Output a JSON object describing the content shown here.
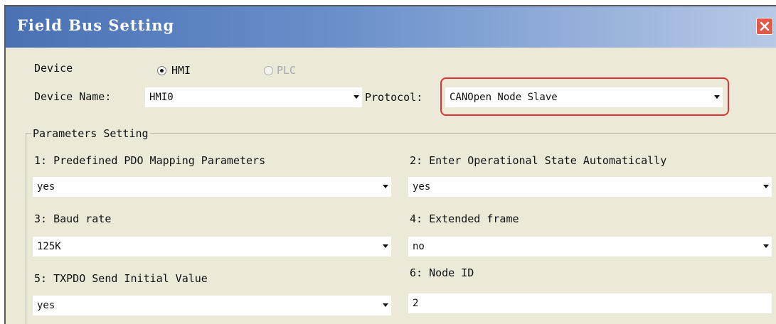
{
  "window": {
    "title": "Field Bus Setting"
  },
  "device": {
    "label": "Device",
    "options": [
      {
        "label": "HMI",
        "selected": true,
        "enabled": true
      },
      {
        "label": "PLC",
        "selected": false,
        "enabled": false
      }
    ]
  },
  "device_name": {
    "label": "Device Name:",
    "value": "HMI0"
  },
  "protocol": {
    "label": "Protocol:",
    "value": "CANOpen Node Slave"
  },
  "parameters": {
    "group_label": "Parameters Setting",
    "items": [
      {
        "label": "1: Predefined PDO Mapping Parameters",
        "value": "yes",
        "type": "dropdown"
      },
      {
        "label": "2: Enter Operational State Automatically",
        "value": "yes",
        "type": "dropdown"
      },
      {
        "label": "3: Baud rate",
        "value": "125K",
        "type": "dropdown"
      },
      {
        "label": "4: Extended frame",
        "value": "no",
        "type": "dropdown"
      },
      {
        "label": "5: TXPDO Send Initial Value",
        "value": "yes",
        "type": "dropdown"
      },
      {
        "label": "6: Node ID",
        "value": "2",
        "type": "text"
      }
    ]
  },
  "colors": {
    "highlight": "#e03030",
    "titlebar_start": "#4a71b3",
    "titlebar_end": "#b8c9e6",
    "dialog_bg": "#ece9d8",
    "close_button": "#e05a4a"
  },
  "icons": {
    "close": "close-x-icon",
    "dropdown": "dropdown-arrow-icon"
  }
}
